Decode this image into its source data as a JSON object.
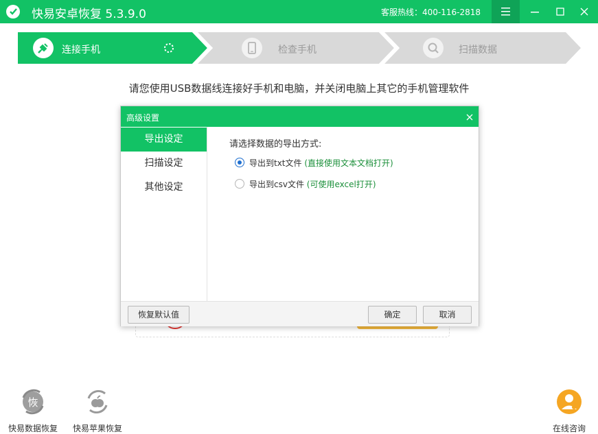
{
  "app": {
    "title": "快易安卓恢复  5.3.9.0",
    "hotline": "客服热线：400-116-2818",
    "logo_icon": "shield-check-icon"
  },
  "window_controls": [
    {
      "name": "menu-icon"
    },
    {
      "name": "minimize-icon"
    },
    {
      "name": "maximize-icon"
    },
    {
      "name": "close-icon"
    }
  ],
  "steps": [
    {
      "label": "连接手机",
      "icon": "usb-plug-icon",
      "active": true
    },
    {
      "label": "检查手机",
      "icon": "phone-icon",
      "active": false
    },
    {
      "label": "扫描数据",
      "icon": "magnifier-icon",
      "active": false
    }
  ],
  "instruction": "请您使用USB数据线连接好手机和电脑，并关闭电脑上其它的手机管理软件",
  "dialog": {
    "title": "高级设置",
    "tabs": [
      {
        "label": "导出设定",
        "active": true
      },
      {
        "label": "扫描设定",
        "active": false
      },
      {
        "label": "其他设定",
        "active": false
      }
    ],
    "heading": "请选择数据的导出方式:",
    "options": [
      {
        "label": "导出到txt文件",
        "hint": "(直接使用文本文档打开)",
        "checked": true
      },
      {
        "label": "导出到csv文件",
        "hint": "(可使用excel打开)",
        "checked": false
      }
    ],
    "restore_label": "恢复默认值",
    "ok_label": "确定",
    "cancel_label": "取消"
  },
  "bottom_tools": [
    {
      "label": "快易数据恢复",
      "glyph": "恢",
      "icon": "data-recovery-icon"
    },
    {
      "label": "快易苹果恢复",
      "icon": "apple-recovery-icon"
    }
  ],
  "consult": {
    "label": "在线咨询",
    "icon": "support-agent-icon"
  },
  "colors": {
    "brand_green": "#12c265",
    "dark_green": "#0fa357",
    "step_gray": "#d6d6d6",
    "accent_orange": "#f5a623"
  }
}
